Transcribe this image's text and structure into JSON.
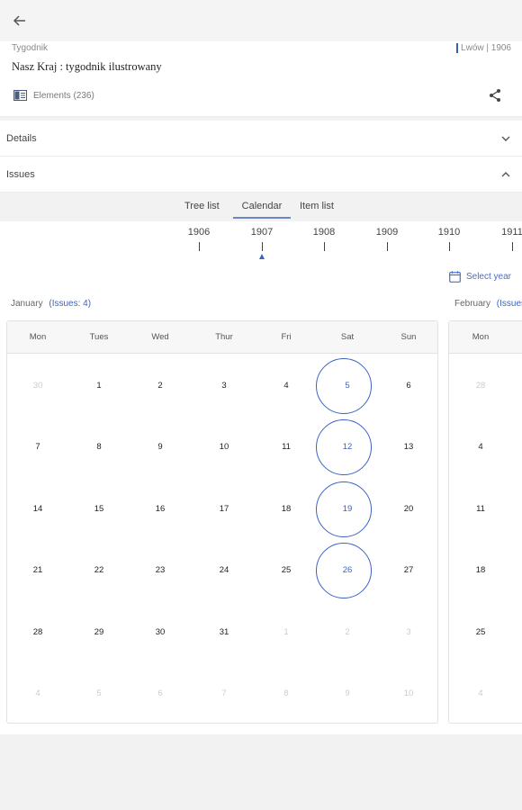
{
  "header": {
    "type_label": "Tygodnik",
    "place_date": "Lwów | 1906",
    "title": "Nasz Kraj : tygodnik ilustrowany",
    "elements_label": "Elements (236)"
  },
  "sections": {
    "details": "Details",
    "issues": "Issues"
  },
  "tabs": [
    "Tree list",
    "Calendar",
    "Item list"
  ],
  "active_tab": "Calendar",
  "years": [
    "1906",
    "1907",
    "1908",
    "1909",
    "1910",
    "1911"
  ],
  "selected_year": "1907",
  "select_year_label": "Select year",
  "weekdays": [
    "Mon",
    "Tues",
    "Wed",
    "Thur",
    "Fri",
    "Sat",
    "Sun"
  ],
  "months": [
    {
      "name": "January",
      "issues_label": "(Issues: 4)",
      "weeks": [
        [
          "30",
          "1",
          "2",
          "3",
          "4",
          "5",
          "6"
        ],
        [
          "7",
          "8",
          "9",
          "10",
          "11",
          "12",
          "13"
        ],
        [
          "14",
          "15",
          "16",
          "17",
          "18",
          "19",
          "20"
        ],
        [
          "21",
          "22",
          "23",
          "24",
          "25",
          "26",
          "27"
        ],
        [
          "28",
          "29",
          "30",
          "31",
          "1",
          "2",
          "3"
        ],
        [
          "4",
          "5",
          "6",
          "7",
          "8",
          "9",
          "10"
        ]
      ],
      "muted": [
        [
          0,
          0
        ],
        [
          4,
          4
        ],
        [
          4,
          5
        ],
        [
          4,
          6
        ],
        [
          5,
          0
        ],
        [
          5,
          1
        ],
        [
          5,
          2
        ],
        [
          5,
          3
        ],
        [
          5,
          4
        ],
        [
          5,
          5
        ],
        [
          5,
          6
        ]
      ],
      "issue_days": [
        "5",
        "12",
        "19",
        "26"
      ]
    },
    {
      "name": "February",
      "issues_label": "(Issues",
      "weeks": [
        [
          "28"
        ],
        [
          "4"
        ],
        [
          "11"
        ],
        [
          "18"
        ],
        [
          "25"
        ],
        [
          "4"
        ]
      ],
      "weekday": "Mon"
    }
  ],
  "colors": {
    "accent": "#3b63c4",
    "muted_text": "#cccccc"
  }
}
